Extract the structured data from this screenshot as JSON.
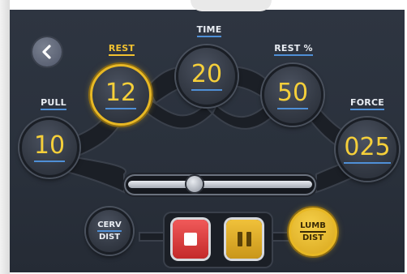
{
  "nav": {
    "back_icon": "chevron-left-icon"
  },
  "labels": {
    "pull": "PULL",
    "rest": "REST",
    "time": "TIME",
    "rest_percent": "REST %",
    "force": "FORCE"
  },
  "values": {
    "pull": "10",
    "rest": "12",
    "time": "20",
    "rest_percent": "50",
    "force": "025"
  },
  "mode": {
    "cerv": {
      "line1": "CERV",
      "line2": "DIST"
    },
    "lumb": {
      "line1": "LUMB",
      "line2": "DIST"
    }
  },
  "controls": {
    "stop_icon": "stop-icon",
    "pause_icon": "pause-icon"
  },
  "slider": {
    "position": 0.35
  },
  "colors": {
    "accent_gold": "#f2c230",
    "underline_blue": "#4f8fd6",
    "stop_red": "#d93a3a",
    "pause_gold": "#e0ad28"
  }
}
